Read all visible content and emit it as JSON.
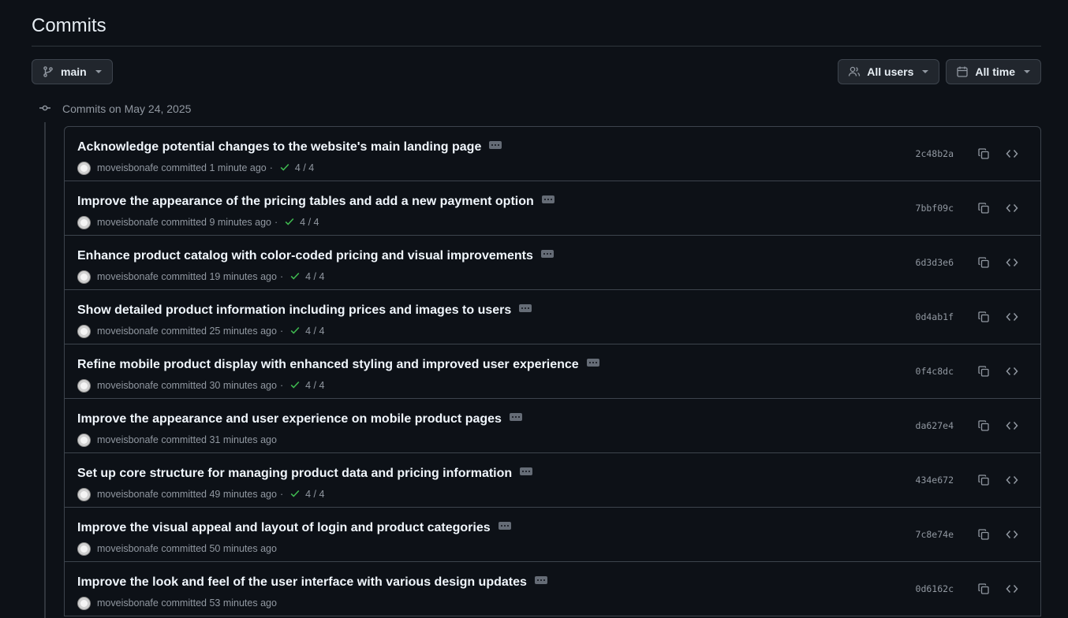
{
  "page": {
    "title": "Commits"
  },
  "toolbar": {
    "branch_label": "main",
    "users_label": "All users",
    "time_label": "All time"
  },
  "group": {
    "heading": "Commits on May 24, 2025"
  },
  "commits": [
    {
      "message": "Acknowledge potential changes to the website's main landing page",
      "author": "moveisbonafe",
      "action": "committed",
      "time": "1 minute ago",
      "checks": "4 / 4",
      "sha": "2c48b2a"
    },
    {
      "message": "Improve the appearance of the pricing tables and add a new payment option",
      "author": "moveisbonafe",
      "action": "committed",
      "time": "9 minutes ago",
      "checks": "4 / 4",
      "sha": "7bbf09c"
    },
    {
      "message": "Enhance product catalog with color-coded pricing and visual improvements",
      "author": "moveisbonafe",
      "action": "committed",
      "time": "19 minutes ago",
      "checks": "4 / 4",
      "sha": "6d3d3e6"
    },
    {
      "message": "Show detailed product information including prices and images to users",
      "author": "moveisbonafe",
      "action": "committed",
      "time": "25 minutes ago",
      "checks": "4 / 4",
      "sha": "0d4ab1f"
    },
    {
      "message": "Refine mobile product display with enhanced styling and improved user experience",
      "author": "moveisbonafe",
      "action": "committed",
      "time": "30 minutes ago",
      "checks": "4 / 4",
      "sha": "0f4c8dc"
    },
    {
      "message": "Improve the appearance and user experience on mobile product pages",
      "author": "moveisbonafe",
      "action": "committed",
      "time": "31 minutes ago",
      "checks": null,
      "sha": "da627e4"
    },
    {
      "message": "Set up core structure for managing product data and pricing information",
      "author": "moveisbonafe",
      "action": "committed",
      "time": "49 minutes ago",
      "checks": "4 / 4",
      "sha": "434e672"
    },
    {
      "message": "Improve the visual appeal and layout of login and product categories",
      "author": "moveisbonafe",
      "action": "committed",
      "time": "50 minutes ago",
      "checks": null,
      "sha": "7c8e74e"
    },
    {
      "message": "Improve the look and feel of the user interface with various design updates",
      "author": "moveisbonafe",
      "action": "committed",
      "time": "53 minutes ago",
      "checks": null,
      "sha": "0d6162c"
    }
  ],
  "icons": {
    "branch": "git-branch-icon",
    "users": "people-icon",
    "time": "calendar-icon",
    "commit": "git-commit-icon",
    "check": "check-icon",
    "copy": "copy-icon",
    "browse": "code-icon",
    "more": "ellipsis-icon"
  },
  "colors": {
    "background": "#0d1117",
    "border": "#3d444d",
    "check": "#3fb950",
    "muted": "#9198a1"
  }
}
